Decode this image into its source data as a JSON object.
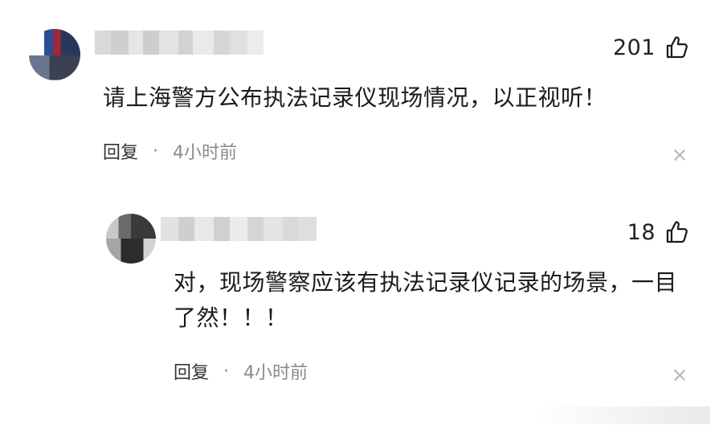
{
  "comments": [
    {
      "likes": "201",
      "text": "请上海警方公布执法记录仪现场情况，以正视听！",
      "reply_label": "回复",
      "separator": "·",
      "time": "4小时前"
    },
    {
      "likes": "18",
      "text": "对，现场警察应该有执法记录仪记录的场景，一目了然！！！",
      "reply_label": "回复",
      "separator": "·",
      "time": "4小时前"
    }
  ],
  "icons": {
    "like": "thumbs-up-icon",
    "dismiss": "close-icon"
  },
  "colors": {
    "text": "#1a1a1a",
    "meta": "#8a8a8a",
    "close": "#b5b5b5"
  }
}
